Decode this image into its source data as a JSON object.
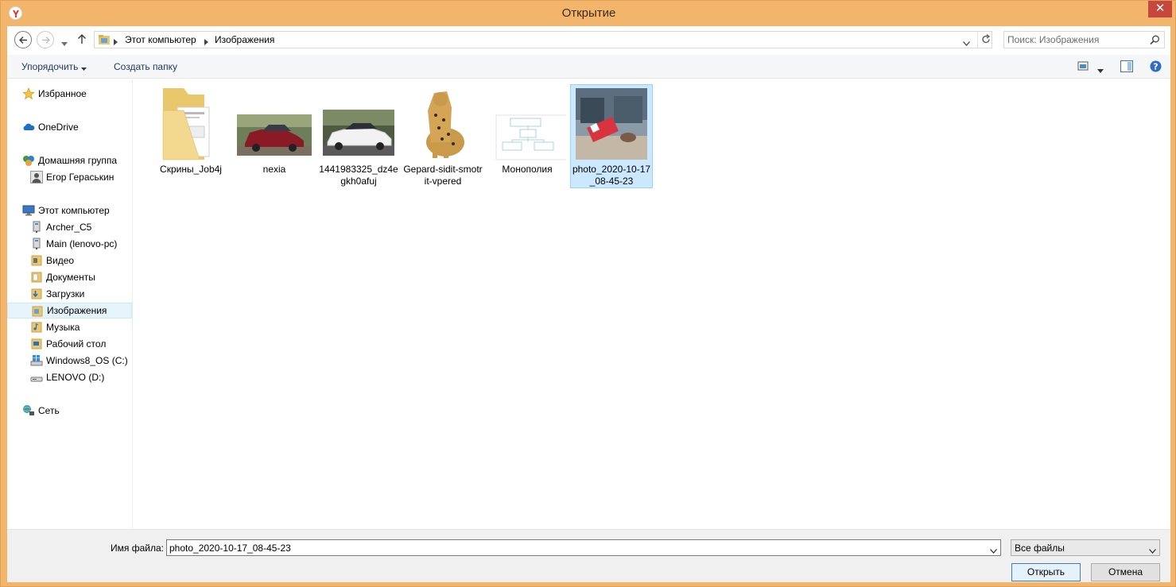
{
  "window": {
    "title": "Открытие",
    "close_label": "✕"
  },
  "address": {
    "crumbs": [
      "Этот компьютер",
      "Изображения"
    ],
    "search_placeholder": "Поиск: Изображения"
  },
  "toolbar": {
    "organize_label": "Упорядочить",
    "new_folder_label": "Создать папку"
  },
  "sidebar": {
    "favorites": "Избранное",
    "onedrive": "OneDrive",
    "homegroup": "Домашняя группа",
    "user": "Егор Гераськин",
    "computer": "Этот компьютер",
    "computer_items": [
      "Archer_C5",
      "Main (lenovo-pc)",
      "Видео",
      "Документы",
      "Загрузки",
      "Изображения",
      "Музыка",
      "Рабочий стол",
      "Windows8_OS (C:)",
      "LENOVO (D:)"
    ],
    "network": "Сеть",
    "selected": "Изображения"
  },
  "files": [
    {
      "name": "Скрины_Job4j",
      "type": "folder"
    },
    {
      "name": "nexia",
      "type": "image"
    },
    {
      "name": "1441983325_dz4egkh0afuj",
      "type": "image"
    },
    {
      "name": "Gepard-sidit-smotrit-vpered",
      "type": "image"
    },
    {
      "name": "Монополия",
      "type": "image"
    },
    {
      "name": "photo_2020-10-17_08-45-23",
      "type": "image",
      "selected": true
    }
  ],
  "bottom": {
    "filename_label": "Имя файла:",
    "filename_value": "photo_2020-10-17_08-45-23",
    "filter_value": "Все файлы",
    "open_label": "Открыть",
    "cancel_label": "Отмена"
  },
  "colors": {
    "title_bar": "#f3b56b",
    "close_button": "#c7463d",
    "selection_bg": "#cce8ff",
    "selection_border": "#99d1ff",
    "link_text": "#1e395b"
  }
}
